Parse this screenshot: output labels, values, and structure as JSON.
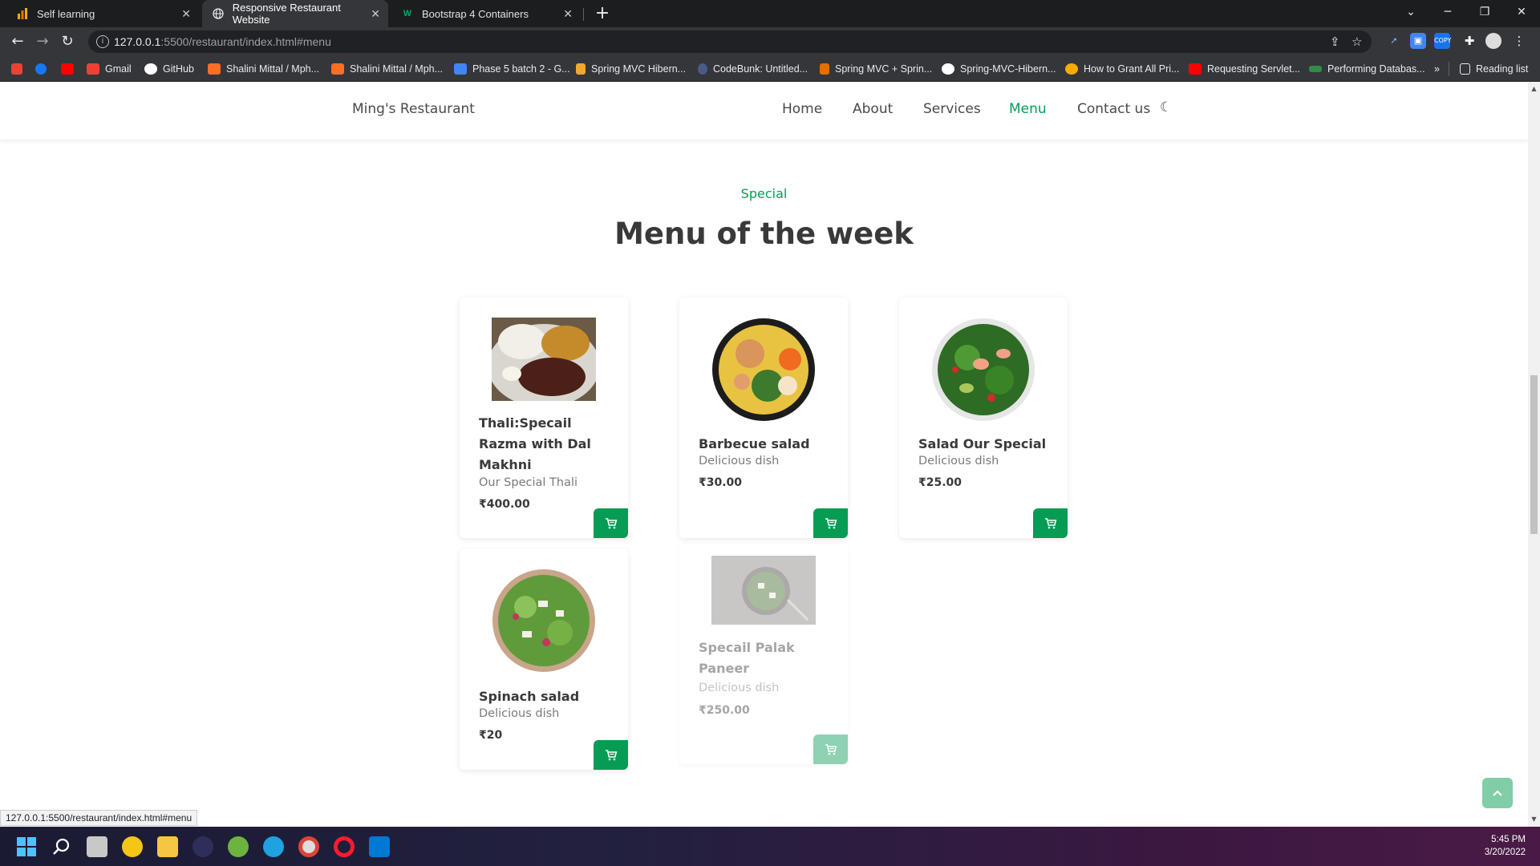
{
  "browser": {
    "tabs": [
      {
        "title": "Self learning",
        "icon": "chart-favicon"
      },
      {
        "title": "Responsive Restaurant Website",
        "icon": "globe-favicon"
      },
      {
        "title": "Bootstrap 4 Containers",
        "icon": "w3schools-favicon"
      }
    ],
    "url_host": "127.0.0.1",
    "url_rest": ":5500/restaurant/index.html#menu",
    "bookmarks": [
      {
        "label": "Gmail",
        "icon": "gmail-icon"
      },
      {
        "label": "GitHub",
        "icon": "github-icon"
      },
      {
        "label": "Shalini Mittal / Mph...",
        "icon": "gitlab-icon"
      },
      {
        "label": "Shalini Mittal / Mph...",
        "icon": "gitlab-icon"
      },
      {
        "label": "Phase 5 batch 2 - G...",
        "icon": "docs-icon"
      },
      {
        "label": "Spring MVC Hibern...",
        "icon": "java-icon"
      },
      {
        "label": "CodeBunk: Untitled...",
        "icon": "codebunk-icon"
      },
      {
        "label": "Spring MVC + Sprin...",
        "icon": "java-icon"
      },
      {
        "label": "Spring-MVC-Hibern...",
        "icon": "globe-icon"
      },
      {
        "label": "How to Grant All Pri...",
        "icon": "info-icon"
      },
      {
        "label": "Requesting Servlet...",
        "icon": "youtube-icon"
      },
      {
        "label": "Performing Databas...",
        "icon": "gfg-icon"
      }
    ],
    "more_bookmarks": "»",
    "reading_list": "Reading list",
    "status_url": "127.0.0.1:5500/restaurant/index.html#menu"
  },
  "site": {
    "logo": "Ming's Restaurant",
    "nav": [
      "Home",
      "About",
      "Services",
      "Menu",
      "Contact us"
    ],
    "active_nav": "Menu",
    "section_subtitle": "Special",
    "section_title": "Menu of the week",
    "items": [
      {
        "name": "Thali:Specail Razma with Dal Makhni",
        "desc": "Our Special Thali",
        "price": "₹400.00",
        "image": "thali-image"
      },
      {
        "name": "Barbecue salad",
        "desc": "Delicious dish",
        "price": "₹30.00",
        "image": "barbecue-salad-image"
      },
      {
        "name": "Salad Our Special",
        "desc": "Delicious dish",
        "price": "₹25.00",
        "image": "special-salad-image"
      },
      {
        "name": "Spinach salad",
        "desc": "Delicious dish",
        "price": "₹20",
        "image": "spinach-salad-image"
      },
      {
        "name": "Specail Palak Paneer",
        "desc": "Delicious dish",
        "price": "₹250.00",
        "image": "palak-paneer-image"
      }
    ]
  },
  "colors": {
    "brand": "#069c54",
    "text": "#393939",
    "muted": "#7a7a7a"
  },
  "taskbar": {
    "time": "5:45 PM",
    "date": "3/20/2022"
  }
}
